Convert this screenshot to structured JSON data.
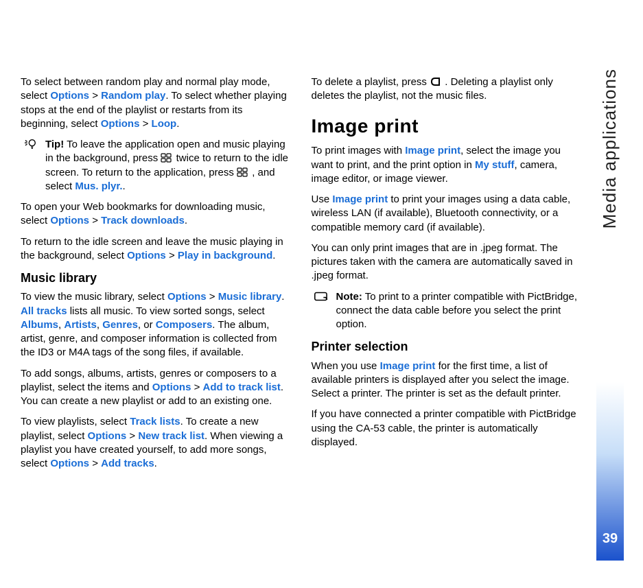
{
  "side": {
    "label": "Media applications",
    "page": "39"
  },
  "left": {
    "p1": {
      "t1": "To select between random play and normal play mode, select ",
      "o1": "Options",
      "gt1": " > ",
      "o2": "Random play",
      "t2": ". To select whether playing stops at the end of the playlist or restarts from its beginning, select ",
      "o3": "Options",
      "gt2": " > ",
      "o4": "Loop",
      "t3": "."
    },
    "tip": {
      "label": "Tip!",
      "t1": " To leave the application open and music playing in the background, press ",
      "t2": " twice to return to the idle screen. To return to the application, press ",
      "t3": " , and select ",
      "o1": "Mus. plyr.",
      "t4": "."
    },
    "p2": {
      "t1": "To open your Web bookmarks for downloading music, select ",
      "o1": "Options",
      "gt": " > ",
      "o2": "Track downloads",
      "t2": "."
    },
    "p3": {
      "t1": "To return to the idle screen and leave the music playing in the background, select ",
      "o1": "Options",
      "gt": " > ",
      "o2": "Play in background",
      "t2": "."
    },
    "h3a": "Music library",
    "p4": {
      "t1": "To view the music library, select ",
      "o1": "Options",
      "gt": " > ",
      "o2": "Music library",
      "t2": ". ",
      "o3": "All tracks",
      "t3": " lists all music. To view sorted songs, select ",
      "o4": "Albums",
      "c1": ", ",
      "o5": "Artists",
      "c2": ", ",
      "o6": "Genres",
      "c3": ", or ",
      "o7": "Composers",
      "t4": ". The album, artist, genre, and composer information is collected from the ID3 or M4A tags of the song files, if available."
    },
    "p5": {
      "t1": "To add songs, albums, artists, genres or composers to a playlist, select the items and ",
      "o1": "Options",
      "gt": " > ",
      "o2": "Add to track list",
      "t2": ". You can create a new playlist or add to an existing one."
    },
    "p6": {
      "t1": "To view playlists, select ",
      "o1": "Track lists",
      "t2": ". To create a new playlist, select ",
      "o2": "Options",
      "gt": " > ",
      "o3": "New track list",
      "t3": ". When viewing a playlist you have created yourself, to add more songs, select ",
      "o4": "Options",
      "gt2": " > ",
      "o5": "Add tracks",
      "t4": "."
    }
  },
  "right": {
    "p1": {
      "t1": "To delete a playlist, press ",
      "t2": " . Deleting a playlist only deletes the playlist, not the music files."
    },
    "h2a": "Image print",
    "p2": {
      "t1": "To print images with ",
      "o1": "Image print",
      "t2": ", select the image you want to print, and the print option in ",
      "o2": "My stuff",
      "t3": ", camera, image editor, or image viewer."
    },
    "p3": {
      "t1": "Use ",
      "o1": "Image print",
      "t2": " to print your images using a data cable, wireless LAN (if available), Bluetooth connectivity, or a compatible memory card (if available)."
    },
    "p4": "You can only print images that are in .jpeg format. The pictures taken with the camera are automatically saved in .jpeg format.",
    "note": {
      "label": "Note:",
      "t1": " To print to a printer compatible with PictBridge, connect the data cable before you select the print option."
    },
    "h3a": "Printer selection",
    "p5": {
      "t1": "When you use ",
      "o1": "Image print",
      "t2": " for the first time, a list of available printers is displayed after you select the image. Select a printer. The printer is set as the default printer."
    },
    "p6": "If you have connected a printer compatible with PictBridge using the CA-53 cable, the printer is automatically displayed."
  }
}
